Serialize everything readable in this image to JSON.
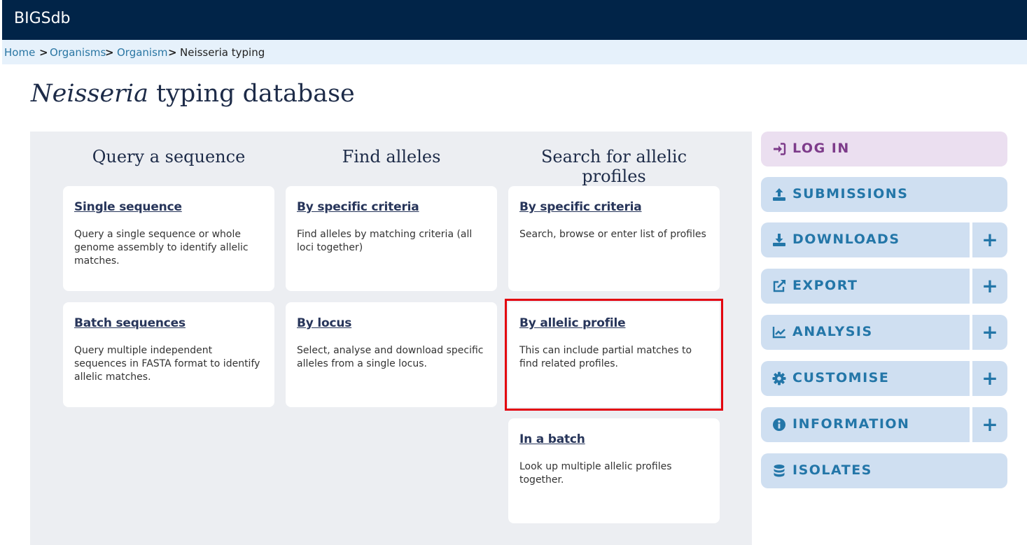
{
  "header": {
    "brand": "BIGSdb"
  },
  "breadcrumb": {
    "items": [
      "Home",
      "Organisms",
      "Organism"
    ],
    "current": "Neisseria typing",
    "separator": ">"
  },
  "page": {
    "title_italic": "Neisseria",
    "title_rest": " typing database"
  },
  "columns": [
    {
      "heading": "Query a sequence",
      "cards": [
        {
          "title": "Single sequence",
          "desc": "Query a single sequence or whole genome assembly to identify allelic matches."
        },
        {
          "title": "Batch sequences",
          "desc": "Query multiple independent sequences in FASTA format to identify allelic matches."
        }
      ]
    },
    {
      "heading": "Find alleles",
      "cards": [
        {
          "title": "By specific criteria",
          "desc": "Find alleles by matching criteria (all loci together)"
        },
        {
          "title": "By locus",
          "desc": "Select, analyse and download specific alleles from a single locus."
        }
      ]
    },
    {
      "heading": "Search for allelic profiles",
      "cards": [
        {
          "title": "By specific criteria",
          "desc": "Search, browse or enter list of profiles"
        },
        {
          "title": "By allelic profile",
          "desc": "This can include partial matches to find related profiles."
        },
        {
          "title": "In a batch",
          "desc": "Look up multiple allelic profiles together."
        }
      ]
    }
  ],
  "sidebar": {
    "items": [
      {
        "label": "LOG IN",
        "icon": "sign-in-icon"
      },
      {
        "label": "SUBMISSIONS",
        "icon": "upload-icon"
      },
      {
        "label": "DOWNLOADS",
        "icon": "download-icon",
        "expand": "+"
      },
      {
        "label": "EXPORT",
        "icon": "external-link-icon",
        "expand": "+"
      },
      {
        "label": "ANALYSIS",
        "icon": "chart-line-icon",
        "expand": "+"
      },
      {
        "label": "CUSTOMISE",
        "icon": "cog-icon",
        "expand": "+"
      },
      {
        "label": "INFORMATION",
        "icon": "info-circle-icon",
        "expand": "+"
      },
      {
        "label": "ISOLATES",
        "icon": "database-icon"
      }
    ]
  },
  "colors": {
    "header_bg": "#012448",
    "breadcrumb_bg": "#e6f1fb",
    "panel_bg": "#eceef2",
    "sidebar_btn_bg": "#cfdff1",
    "login_bg": "#ebdff0",
    "accent": "#2376a8",
    "highlight": "#e3000e"
  }
}
